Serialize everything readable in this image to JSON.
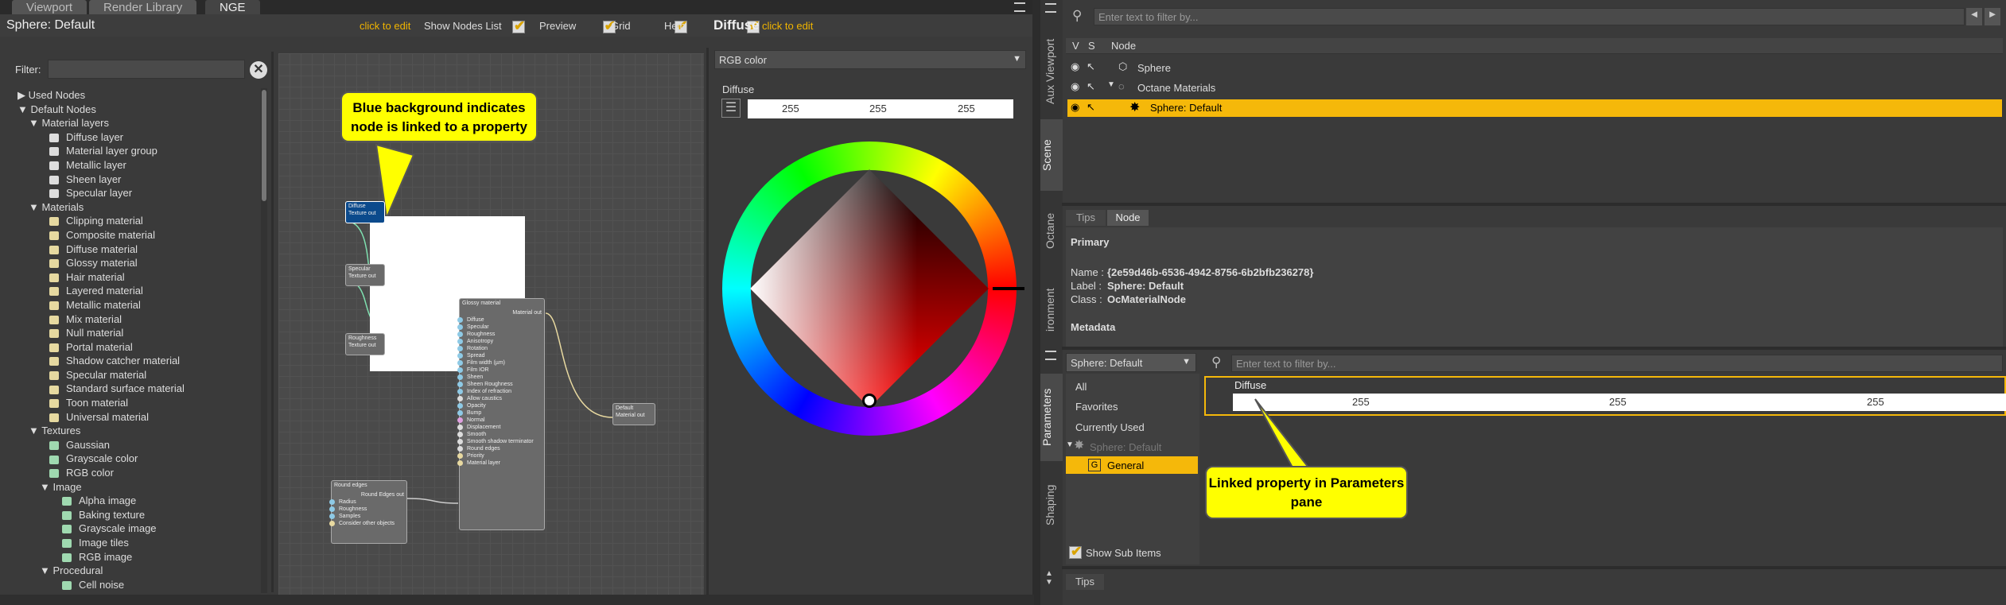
{
  "tabs": [
    "Viewport",
    "Render Library",
    "NGE"
  ],
  "nge": {
    "title": "Sphere: Default",
    "click_edit": "click to edit",
    "show_nodes": "Show Nodes List",
    "preview": "Preview",
    "grid": "Grid",
    "help": "Help",
    "diffuse": "Diffuse",
    "click_edit2": "click to edit",
    "filter": "Filter:"
  },
  "tree": [
    {
      "t": "▶ Used Nodes",
      "l": 0,
      "c": ""
    },
    {
      "t": "▼ Default Nodes",
      "l": 0,
      "c": ""
    },
    {
      "t": "▼ Material layers",
      "l": 1,
      "c": ""
    },
    {
      "t": "Diffuse layer",
      "l": 2,
      "c": "#ddd"
    },
    {
      "t": "Material layer group",
      "l": 2,
      "c": "#ddd"
    },
    {
      "t": "Metallic layer",
      "l": 2,
      "c": "#ddd"
    },
    {
      "t": "Sheen layer",
      "l": 2,
      "c": "#ddd"
    },
    {
      "t": "Specular layer",
      "l": 2,
      "c": "#ddd"
    },
    {
      "t": "▼ Materials",
      "l": 1,
      "c": ""
    },
    {
      "t": "Clipping material",
      "l": 2,
      "c": "#e6d9a0"
    },
    {
      "t": "Composite material",
      "l": 2,
      "c": "#e6d9a0"
    },
    {
      "t": "Diffuse material",
      "l": 2,
      "c": "#e6d9a0"
    },
    {
      "t": "Glossy material",
      "l": 2,
      "c": "#e6d9a0"
    },
    {
      "t": "Hair material",
      "l": 2,
      "c": "#e6d9a0"
    },
    {
      "t": "Layered material",
      "l": 2,
      "c": "#e6d9a0"
    },
    {
      "t": "Metallic material",
      "l": 2,
      "c": "#e6d9a0"
    },
    {
      "t": "Mix material",
      "l": 2,
      "c": "#e6d9a0"
    },
    {
      "t": "Null material",
      "l": 2,
      "c": "#e6d9a0"
    },
    {
      "t": "Portal material",
      "l": 2,
      "c": "#e6d9a0"
    },
    {
      "t": "Shadow catcher material",
      "l": 2,
      "c": "#e6d9a0"
    },
    {
      "t": "Specular material",
      "l": 2,
      "c": "#e6d9a0"
    },
    {
      "t": "Standard surface material",
      "l": 2,
      "c": "#e6d9a0"
    },
    {
      "t": "Toon material",
      "l": 2,
      "c": "#e6d9a0"
    },
    {
      "t": "Universal material",
      "l": 2,
      "c": "#e6d9a0"
    },
    {
      "t": "▼ Textures",
      "l": 1,
      "c": ""
    },
    {
      "t": "Gaussian",
      "l": 2,
      "c": "#9fd9b0"
    },
    {
      "t": "Grayscale color",
      "l": 2,
      "c": "#9fd9b0"
    },
    {
      "t": "RGB color",
      "l": 2,
      "c": "#9fd9b0"
    },
    {
      "t": "▼ Image",
      "l": 2,
      "c": ""
    },
    {
      "t": "Alpha image",
      "l": 3,
      "c": "#9fd9b0"
    },
    {
      "t": "Baking texture",
      "l": 3,
      "c": "#9fd9b0"
    },
    {
      "t": "Grayscale image",
      "l": 3,
      "c": "#9fd9b0"
    },
    {
      "t": "Image tiles",
      "l": 3,
      "c": "#9fd9b0"
    },
    {
      "t": "RGB image",
      "l": 3,
      "c": "#9fd9b0"
    },
    {
      "t": "▼ Procedural",
      "l": 2,
      "c": ""
    },
    {
      "t": "Cell noise",
      "l": 3,
      "c": "#9fd9b0"
    }
  ],
  "graph": {
    "callout": "Blue background indicates node is linked to a property",
    "diffuse_node": [
      "Diffuse",
      "Texture out"
    ],
    "specular_node": [
      "Specular",
      "Texture out"
    ],
    "roughness_node": [
      "Roughness",
      "Texture out"
    ],
    "glossy_title": "Glossy material",
    "glossy_out": "Material out",
    "glossy_pins": [
      "Diffuse",
      "Specular",
      "Roughness",
      "Anisotropy",
      "Rotation",
      "Spread",
      "Film width (µm)",
      "Film IOR",
      "Sheen",
      "Sheen Roughness",
      "Index of refraction",
      "Allow caustics",
      "Opacity",
      "Bump",
      "Normal",
      "Displacement",
      "Smooth",
      "Smooth shadow terminator",
      "Round edges",
      "Priority",
      "Material layer"
    ],
    "default_node": [
      "Default",
      "Material out"
    ],
    "round_title": "Round edges",
    "round_out": "Round Edges out",
    "round_pins": [
      "Radius",
      "Roughness",
      "Samples",
      "Consider other objects"
    ]
  },
  "color": {
    "mode": "RGB color",
    "label": "Diffuse",
    "r": "255",
    "g": "255",
    "b": "255"
  },
  "scene": {
    "filter_ph": "Enter text to filter by...",
    "cols": [
      "V",
      "S",
      "Node"
    ],
    "rows": [
      "Sphere",
      "Octane Materials",
      "Sphere: Default"
    ]
  },
  "side_tabs": [
    "Aux Viewport",
    "Scene",
    "Octane",
    "ironment"
  ],
  "node_panel": {
    "tabs": [
      "Tips",
      "Node"
    ],
    "primary": "Primary",
    "name_label": "Name :",
    "name_val": "{2e59d46b-6536-4942-8756-6b2bfb236278}",
    "label_label": "Label :",
    "label_val": "Sphere: Default",
    "class_label": "Class :",
    "class_val": "OcMaterialNode",
    "metadata": "Metadata"
  },
  "params": {
    "select": "Sphere: Default",
    "filter_ph": "Enter text to filter by...",
    "items": [
      "All",
      "Favorites",
      "Currently Used",
      "Sphere: Default",
      "General"
    ],
    "show_sub": "Show Sub Items",
    "prop": "Diffuse",
    "r": "255",
    "g": "255",
    "b": "255",
    "callout": "Linked property in Parameters pane",
    "tips": "Tips",
    "side": [
      "Parameters",
      "Shaping"
    ]
  }
}
